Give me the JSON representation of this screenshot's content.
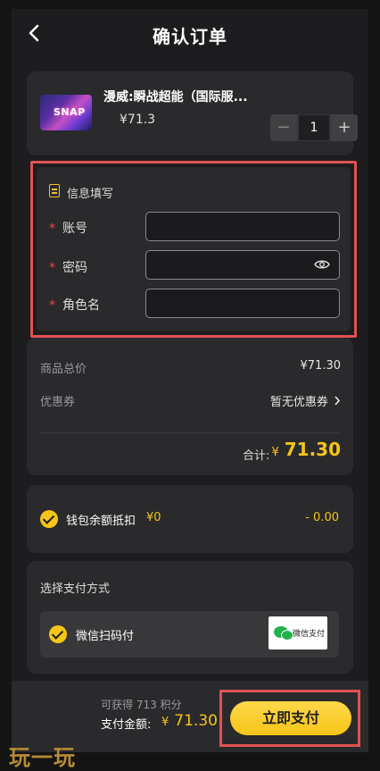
{
  "header": {
    "title": "确认订单",
    "back_icon": "chevron-left-icon"
  },
  "product": {
    "name": "漫威:瞬战超能（国际服...",
    "price": "¥71.3",
    "thumbnail_text": "SNAP",
    "quantity": "1",
    "minus_label": "−",
    "plus_label": "+"
  },
  "info": {
    "title": "信息填写",
    "required_mark": "*",
    "fields": [
      {
        "label": "账号",
        "value": ""
      },
      {
        "label": "密码",
        "value": ""
      },
      {
        "label": "角色名",
        "value": ""
      }
    ]
  },
  "summary": {
    "goods_total_label": "商品总价",
    "goods_total_value": "¥71.30",
    "coupon_label": "优惠券",
    "coupon_value": "暂无优惠券",
    "total_label": "合计:",
    "total_currency": "¥",
    "total_value": "71.30"
  },
  "wallet": {
    "label": "钱包余额抵扣",
    "balance": "¥0",
    "deduction": "- 0.00"
  },
  "payment": {
    "title": "选择支付方式",
    "option_label": "微信扫码付",
    "logo_text": "微信支付"
  },
  "footer": {
    "points_text": "可获得 713 积分",
    "pay_amount_label": "支付金额:",
    "pay_amount_currency": "¥",
    "pay_amount_value": "71.30",
    "pay_button_label": "立即支付"
  },
  "watermark": "玩一玩",
  "colors": {
    "accent": "#f5c518",
    "highlight_border": "#e05252",
    "required": "#e84848",
    "background": "#1d1d1f",
    "card": "#2a2a2c"
  }
}
